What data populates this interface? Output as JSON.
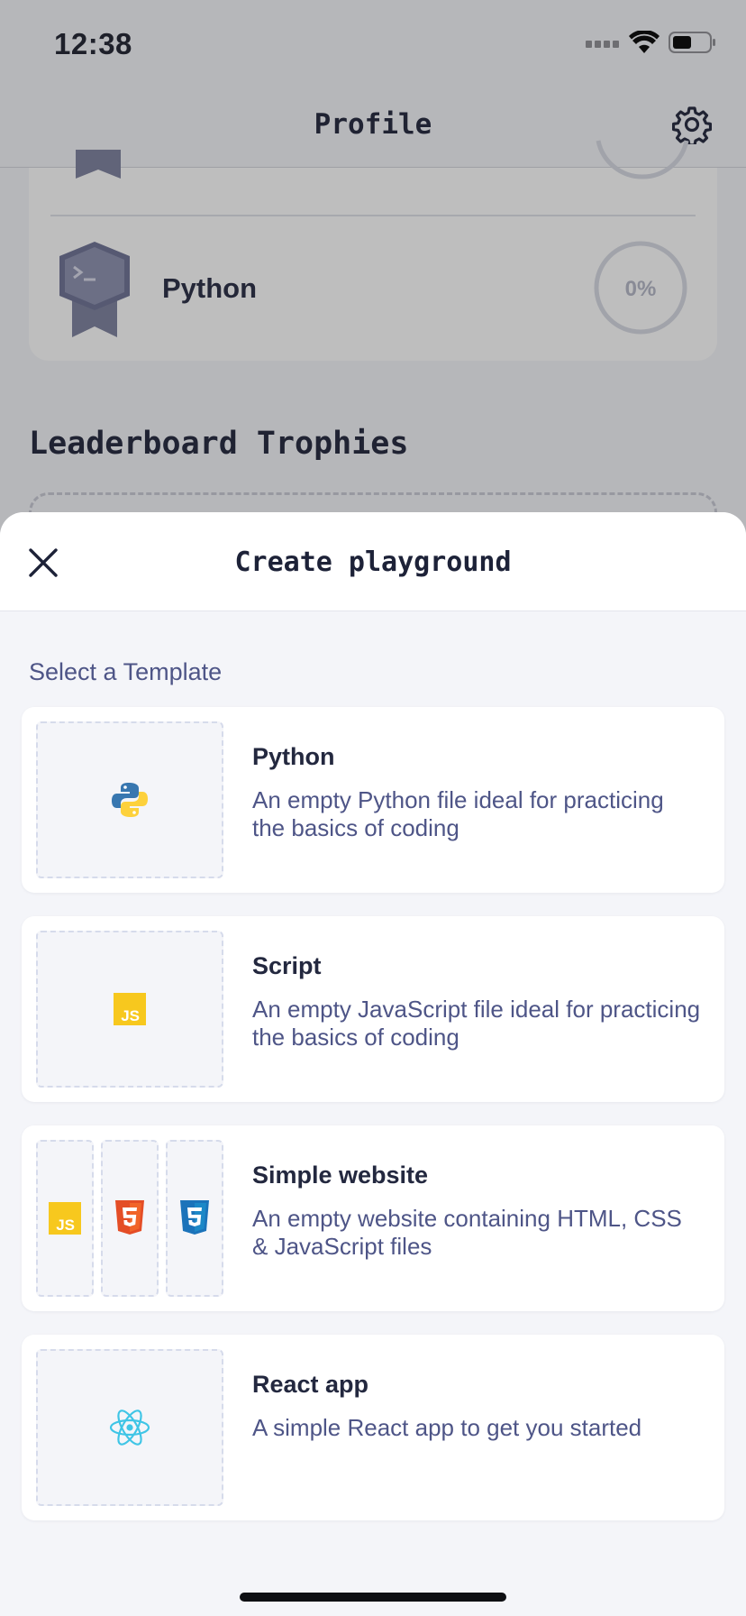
{
  "status_bar": {
    "time": "12:38"
  },
  "header": {
    "title": "Profile"
  },
  "course": {
    "name": "Python",
    "progress_label": "0%"
  },
  "trophies": {
    "title": "Leaderboard Trophies"
  },
  "sheet": {
    "title": "Create playground",
    "section_label": "Select a Template",
    "templates": [
      {
        "title": "Python",
        "description": "An empty Python file ideal for practicing the basics of coding"
      },
      {
        "title": "Script",
        "description": "An empty JavaScript file ideal for practicing the basics of coding"
      },
      {
        "title": "Simple website",
        "description": "An empty website containing HTML, CSS & JavaScript files"
      },
      {
        "title": "React app",
        "description": "A simple React app to get you started"
      }
    ]
  },
  "colors": {
    "js_yellow": "#f7c81e",
    "html_orange": "#e44d26",
    "css_blue": "#1b73ba",
    "react_cyan": "#3fc5e6"
  },
  "icons": [
    "settings-gear-icon",
    "close-icon",
    "python-logo-icon",
    "js-logo-icon",
    "html5-logo-icon",
    "css3-logo-icon",
    "react-logo-icon"
  ]
}
